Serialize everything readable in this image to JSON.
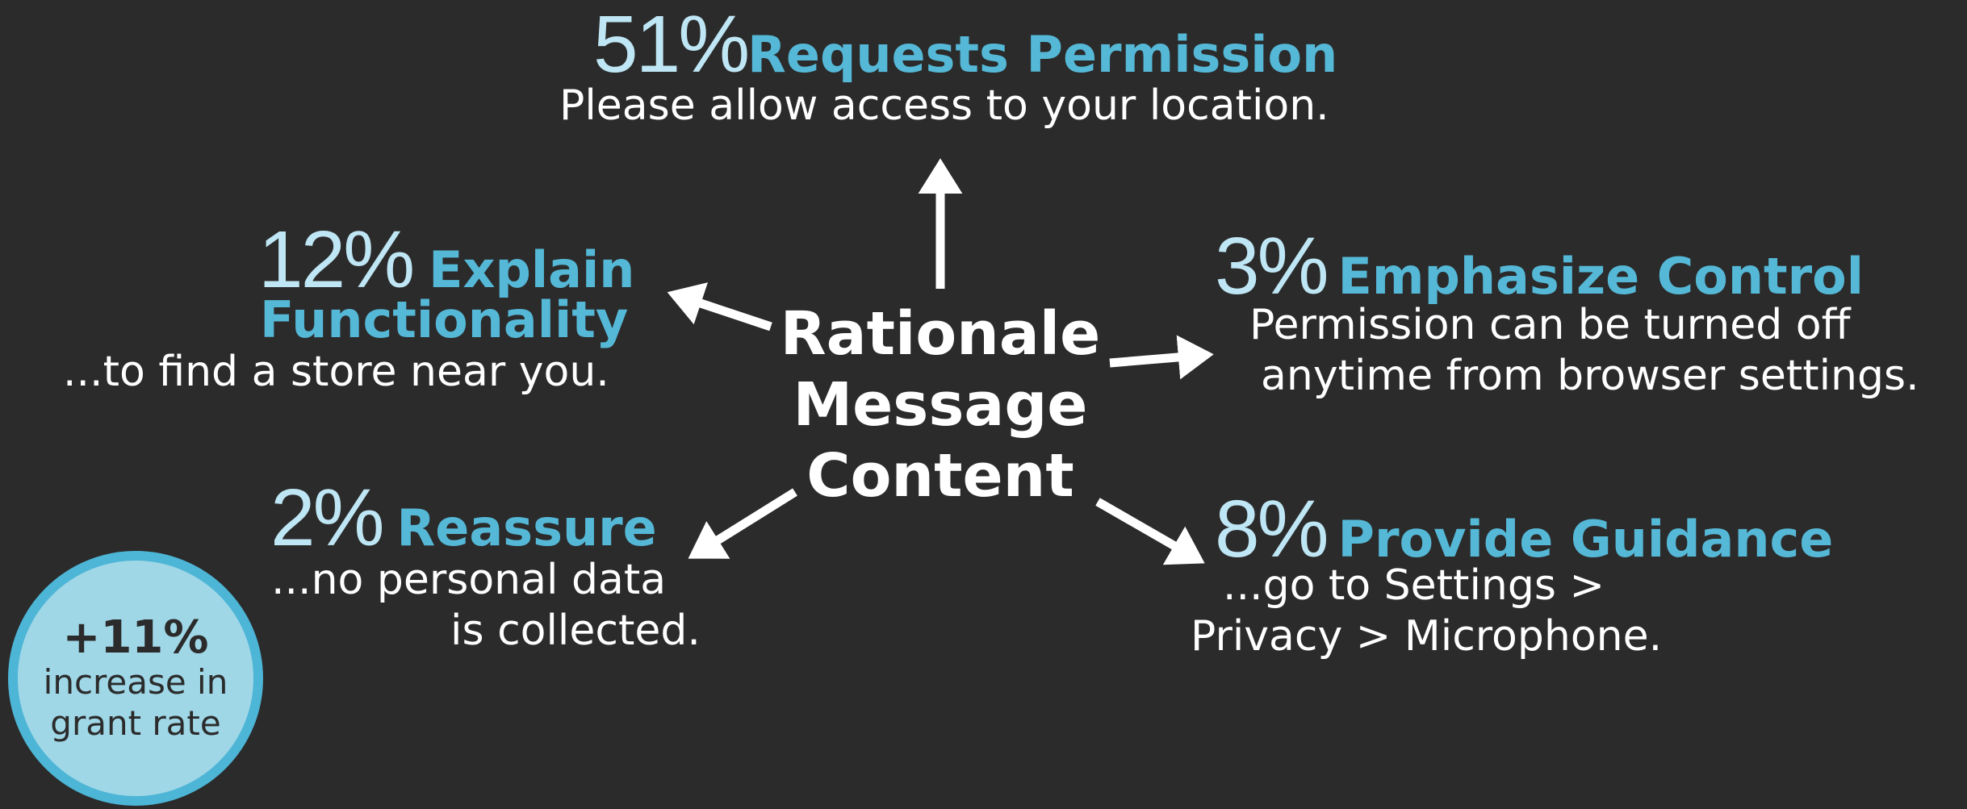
{
  "center": {
    "lines": [
      "Rationale",
      "Message",
      "Content"
    ]
  },
  "categories": {
    "requests_permission": {
      "percent": "51%",
      "title": "Requests Permission",
      "desc": [
        "Please allow access to your location."
      ]
    },
    "explain_functionality": {
      "percent": "12%",
      "title_line1": "Explain",
      "title_line2": "Functionality",
      "desc": [
        "...to find a store near you."
      ]
    },
    "emphasize_control": {
      "percent": "3%",
      "title": "Emphasize Control",
      "desc": [
        "Permission can be turned off",
        "anytime from browser settings."
      ]
    },
    "reassure": {
      "percent": "2%",
      "title": "Reassure",
      "desc": [
        "...no personal data",
        "is collected."
      ]
    },
    "provide_guidance": {
      "percent": "8%",
      "title": "Provide Guidance",
      "desc": [
        "...go to Settings >",
        "Privacy > Microphone."
      ]
    }
  },
  "badge": {
    "value": "+11%",
    "line1": "increase in",
    "line2": "grant rate"
  },
  "colors": {
    "background": "#2b2b2b",
    "percent": "#bfe6f4",
    "title": "#55b8d7",
    "text": "#ffffff",
    "badge_fill": "#9fd7e7",
    "badge_border": "#4db5d6"
  }
}
